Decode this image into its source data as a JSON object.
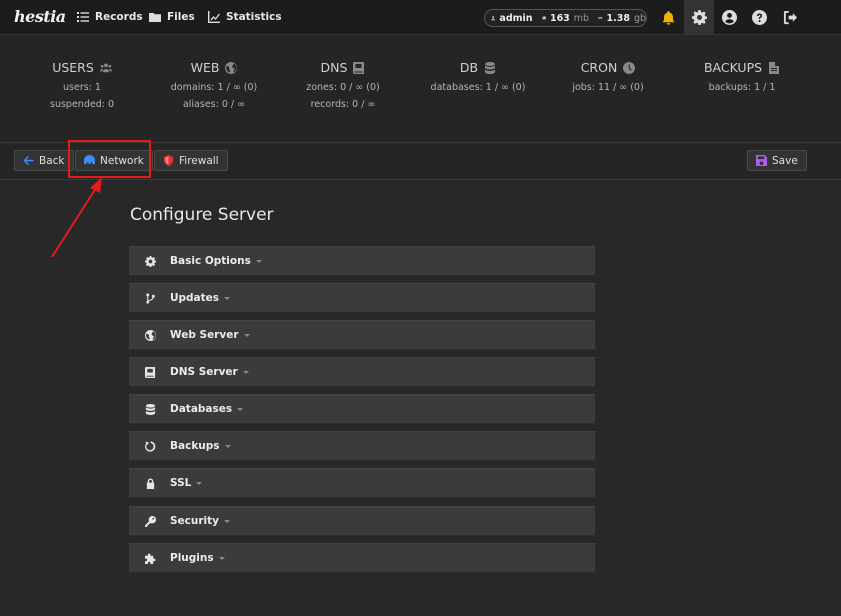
{
  "topbar": {
    "logo": "hestia",
    "nav": [
      {
        "label": "Records",
        "icon": "list-icon"
      },
      {
        "label": "Files",
        "icon": "folder-icon"
      },
      {
        "label": "Statistics",
        "icon": "chart-icon"
      }
    ],
    "user": "admin",
    "disk_value": "163",
    "disk_unit": "mb",
    "bandwidth_value": "1.38",
    "bandwidth_unit": "gb",
    "icons": [
      "bell-icon",
      "gear-icon",
      "user-circle-icon",
      "help-icon",
      "logout-icon"
    ],
    "bell_color": "#f0b400"
  },
  "stats": [
    {
      "title": "USERS",
      "icon": "users-icon",
      "lines": [
        "users: 1",
        "suspended: 0"
      ]
    },
    {
      "title": "WEB",
      "icon": "globe-icon",
      "lines": [
        "domains: 1 / ∞ (0)",
        "aliases: 0 / ∞"
      ]
    },
    {
      "title": "DNS",
      "icon": "book-icon",
      "lines": [
        "zones: 0 / ∞ (0)",
        "records: 0 / ∞"
      ]
    },
    {
      "title": "DB",
      "icon": "database-icon",
      "lines": [
        "databases: 1 / ∞ (0)"
      ]
    },
    {
      "title": "CRON",
      "icon": "clock-icon",
      "lines": [
        "jobs: 11 / ∞ (0)"
      ]
    },
    {
      "title": "BACKUPS",
      "icon": "file-icon",
      "lines": [
        "backups: 1 / 1"
      ]
    }
  ],
  "toolbar": {
    "back_label": "Back",
    "network_label": "Network",
    "firewall_label": "Firewall",
    "save_label": "Save",
    "accent_blue": "#3d8bff",
    "accent_red": "#e0302d",
    "accent_purple": "#b35cf2"
  },
  "main": {
    "title": "Configure Server",
    "sections": [
      {
        "label": "Basic Options",
        "icon": "gear-icon"
      },
      {
        "label": "Updates",
        "icon": "code-branch-icon"
      },
      {
        "label": "Web Server",
        "icon": "globe-icon"
      },
      {
        "label": "DNS Server",
        "icon": "book-icon"
      },
      {
        "label": "Databases",
        "icon": "database-icon"
      },
      {
        "label": "Backups",
        "icon": "rotate-left-icon"
      },
      {
        "label": "SSL",
        "icon": "lock-icon"
      },
      {
        "label": "Security",
        "icon": "key-icon"
      },
      {
        "label": "Plugins",
        "icon": "puzzle-icon"
      }
    ]
  },
  "annotation": {
    "color": "#e21b1b"
  }
}
